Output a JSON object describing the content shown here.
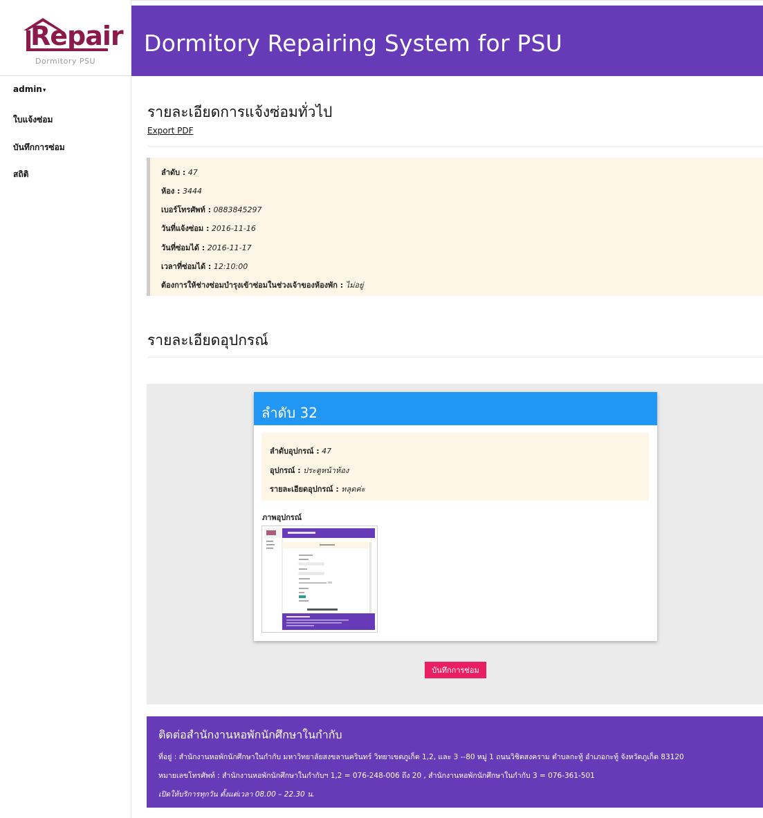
{
  "brand": {
    "logo_text": "Repair",
    "logo_sub": "Dormitory PSU",
    "logo_color": "#8b1a4a"
  },
  "header": {
    "title": "Dormitory Repairing System for PSU",
    "bg": "#673ab7"
  },
  "sidebar": {
    "user": "admin",
    "items": [
      {
        "label": "ใบแจ้งซ่อม"
      },
      {
        "label": "บันทึกการซ่อม"
      },
      {
        "label": "สถิติ"
      }
    ]
  },
  "main": {
    "title": "รายละเอียดการแจ้งซ่อมทั่วไป",
    "export_label": "Export PDF",
    "details": [
      {
        "label": "ลำดับ :",
        "value": "47"
      },
      {
        "label": "ห้อง :",
        "value": "3444"
      },
      {
        "label": "เบอร์โทรศัพท์ :",
        "value": "0883845297"
      },
      {
        "label": "วันที่แจ้งซ่อม :",
        "value": "2016-11-16"
      },
      {
        "label": "วันที่ซ่อมได้ :",
        "value": "2016-11-17"
      },
      {
        "label": "เวลาที่ซ่อมได้ :",
        "value": "12:10:00"
      },
      {
        "label": "ต้องการให้ช่างซ่อมบำรุงเข้าซ่อมในช่วงเจ้าของห้องพัก :",
        "value": "ไม่อยู่"
      }
    ],
    "equipment_title": "รายละเอียดอุปกรณ์",
    "card": {
      "title": "ลำดับ 32",
      "rows": [
        {
          "label": "ลำดับอุปกรณ์ :",
          "value": "47"
        },
        {
          "label": "อุปกรณ์ :",
          "value": "ประตูหน้าห้อง"
        },
        {
          "label": "รายละเอียดอุปกรณ์ :",
          "value": "หลุดค่ะ"
        }
      ],
      "image_label": "ภาพอุปกรณ์"
    },
    "save_button": "บันทึกการซ่อม"
  },
  "footer": {
    "title": "ติดต่อสำนักงานหอพักนักศึกษาในกำกับ",
    "address": "ที่อยู่ : สำนักงานหอพักนักศึกษาในกำกับ มหาวิทยาลัยสงขลานครินทร์ วิทยาเขตภูเก็ต 1,2, และ 3 --80 หมู่ 1 ถนนวิชิตสงคราม ตำบลกะทู้ อำเภอกะทู้ จังหวัดภูเก็ต 83120",
    "phone": "หมายเลขโทรศัพท์ : สำนักงานหอพักนักศึกษาในกำกับฯ 1,2 = 076-248-006 ถึง 20 , สำนักงานหอพักนักศึกษาในกำกับ 3 = 076-361-501",
    "hours": "เปิดให้บริการทุกวัน ตั้งแต่เวลา 08.00 – 22.30 น."
  }
}
